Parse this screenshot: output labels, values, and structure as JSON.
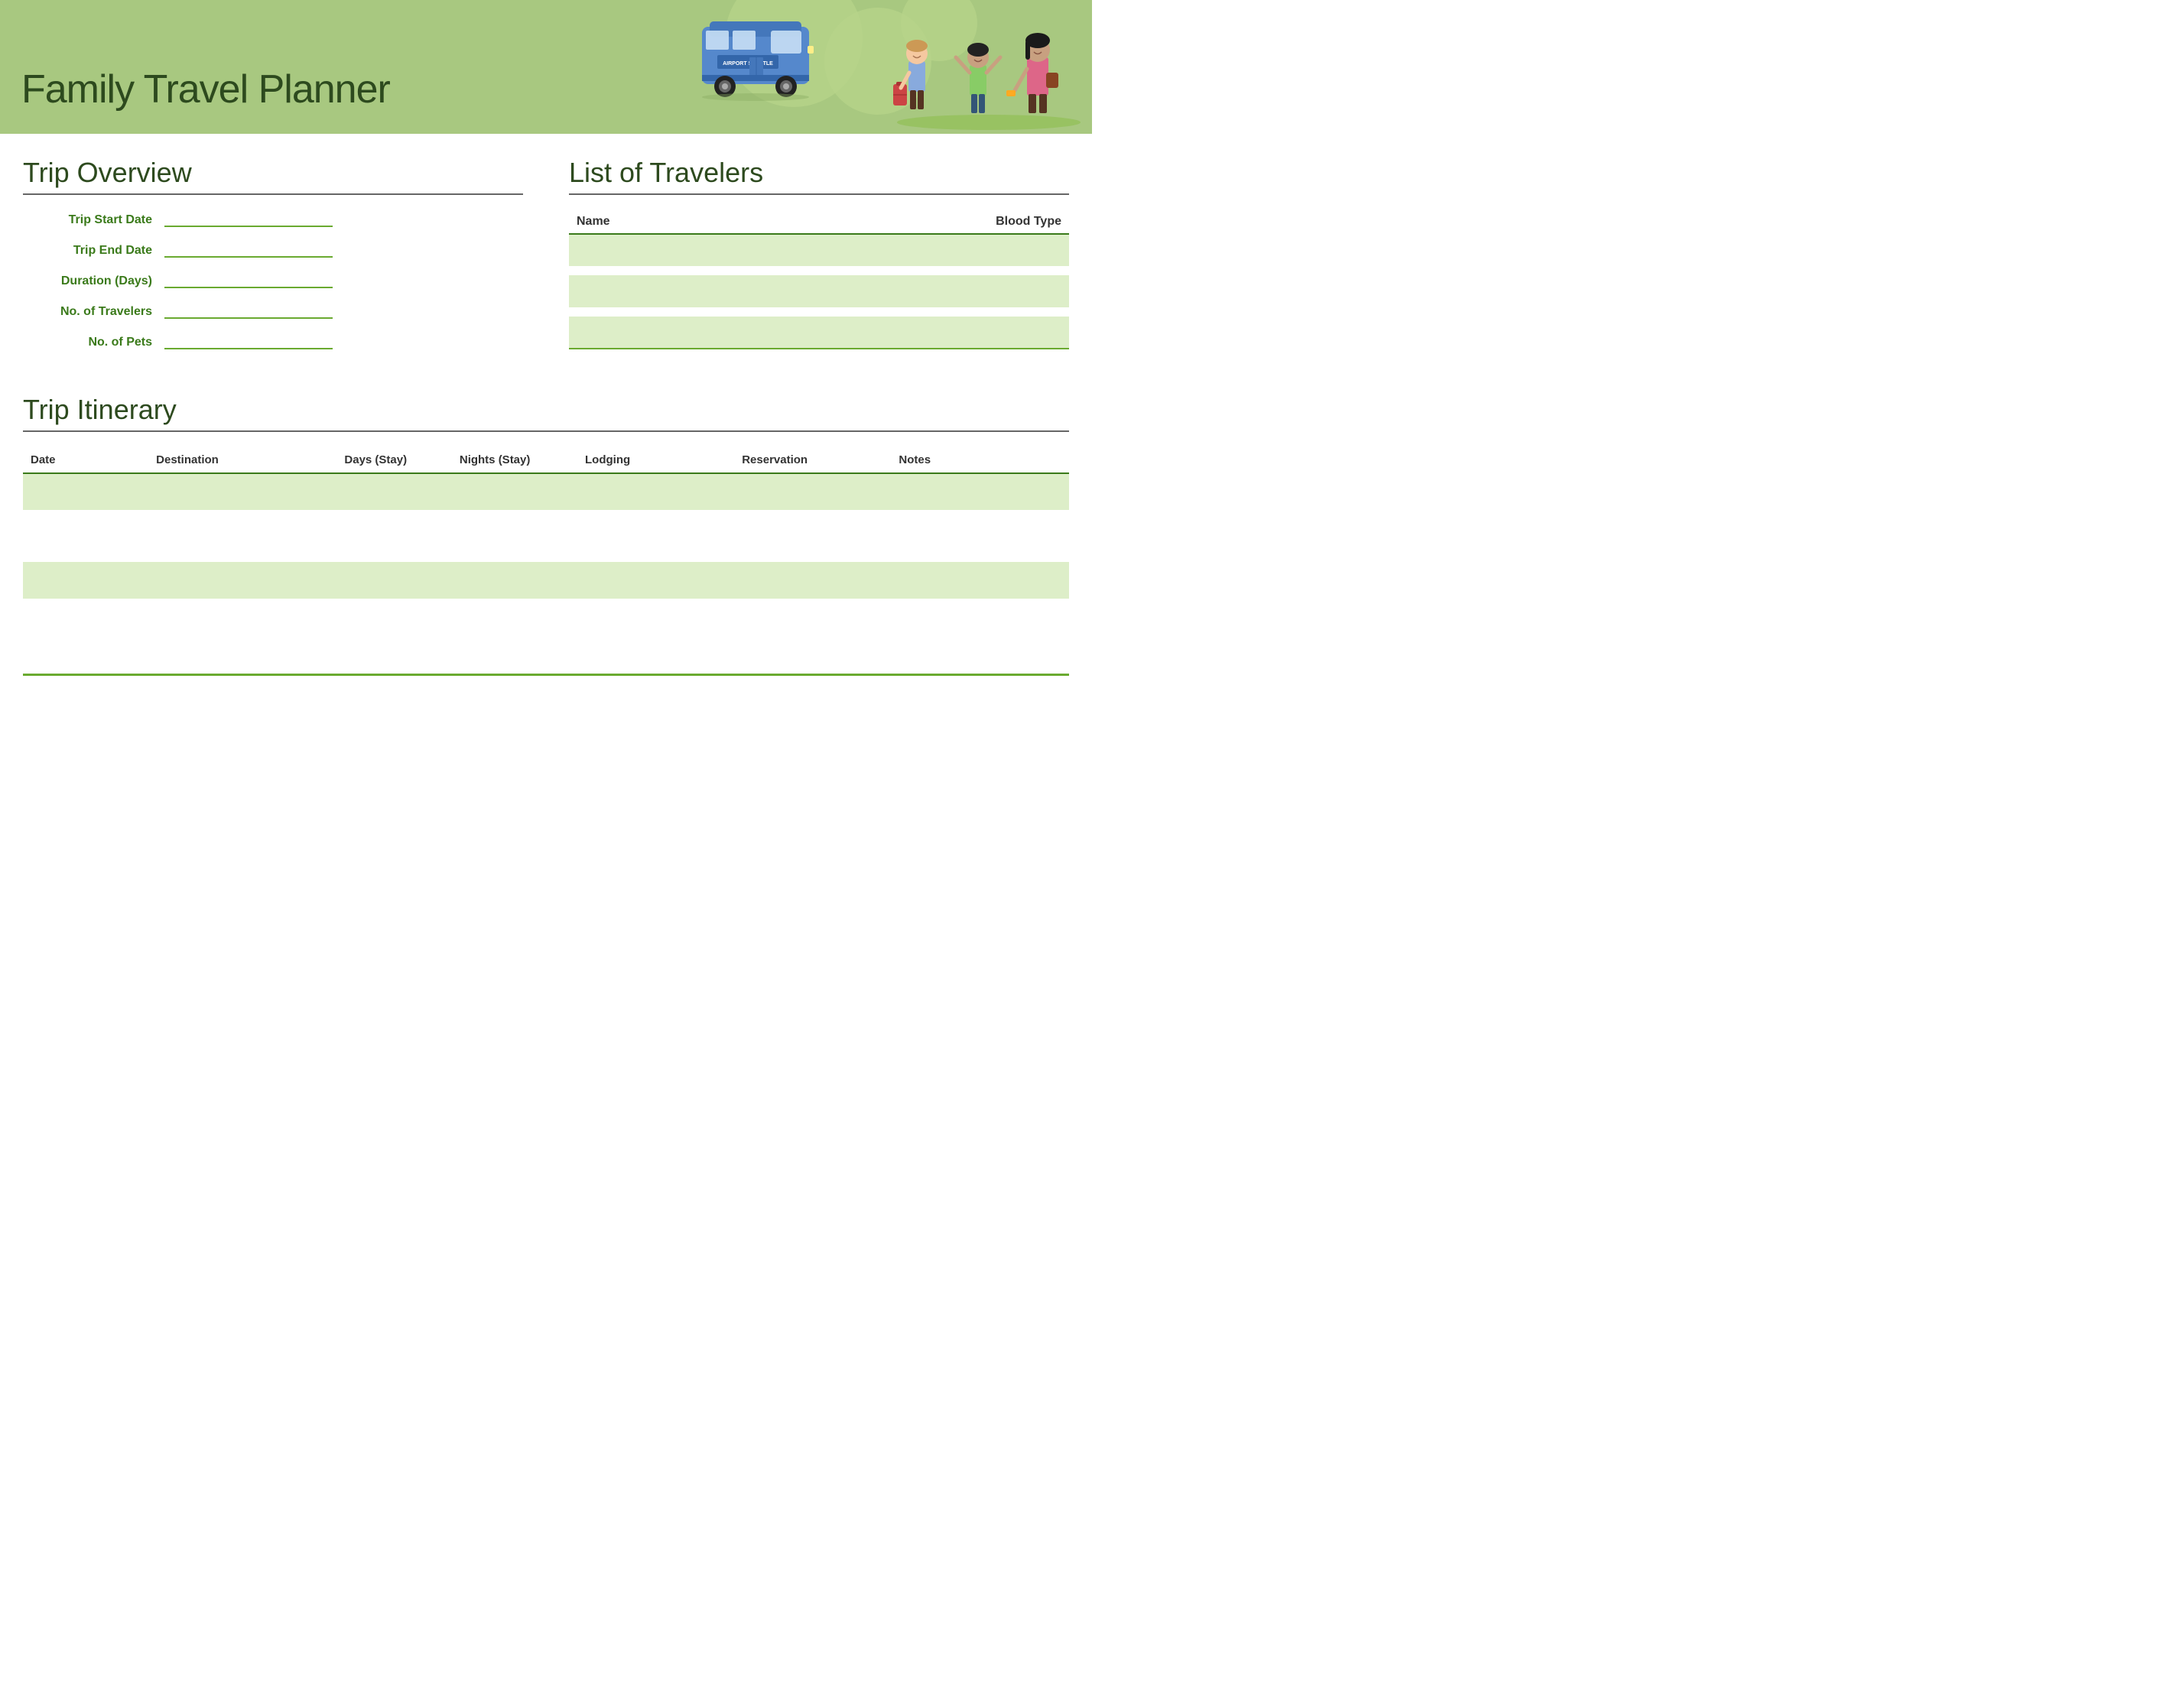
{
  "header": {
    "title": "Family Travel Planner",
    "illustration_alt": "Airport shuttle bus with family travelers"
  },
  "trip_overview": {
    "section_title": "Trip Overview",
    "fields": [
      {
        "label": "Trip Start Date",
        "id": "trip-start-date"
      },
      {
        "label": "Trip End Date",
        "id": "trip-end-date"
      },
      {
        "label": "Duration (Days)",
        "id": "duration-days"
      },
      {
        "label": "No. of Travelers",
        "id": "no-travelers"
      },
      {
        "label": "No. of Pets",
        "id": "no-pets"
      }
    ]
  },
  "travelers": {
    "section_title": "List of Travelers",
    "columns": [
      "Name",
      "Blood Type"
    ],
    "rows": [
      {
        "name": "",
        "blood_type": ""
      },
      {
        "name": "",
        "blood_type": ""
      },
      {
        "name": "",
        "blood_type": ""
      }
    ]
  },
  "itinerary": {
    "section_title": "Trip Itinerary",
    "columns": [
      "Date",
      "Destination",
      "Days (Stay)",
      "Nights (Stay)",
      "Lodging",
      "Reservation",
      "Notes"
    ],
    "rows": [
      {
        "date": "",
        "destination": "",
        "days_stay": "",
        "nights_stay": "",
        "lodging": "",
        "reservation": "",
        "notes": ""
      },
      {
        "date": "",
        "destination": "",
        "days_stay": "",
        "nights_stay": "",
        "lodging": "",
        "reservation": "",
        "notes": ""
      },
      {
        "date": "",
        "destination": "",
        "days_stay": "",
        "nights_stay": "",
        "lodging": "",
        "reservation": "",
        "notes": ""
      },
      {
        "date": "",
        "destination": "",
        "days_stay": "",
        "nights_stay": "",
        "lodging": "",
        "reservation": "",
        "notes": ""
      }
    ]
  },
  "colors": {
    "header_bg": "#a8c880",
    "section_title": "#2d4a1e",
    "field_label": "#3a7a1a",
    "underline": "#6aaa30",
    "row_bg": "#ddeec8",
    "border": "#3a7a1a"
  }
}
